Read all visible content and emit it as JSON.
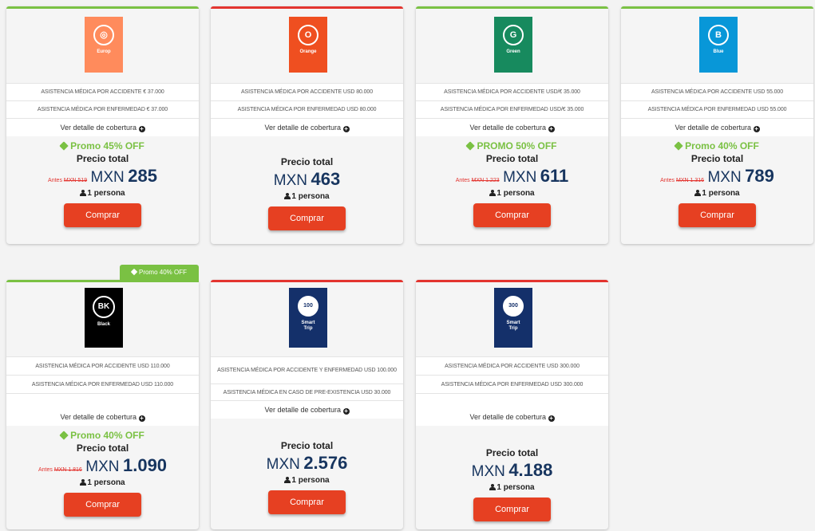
{
  "detail_label": "Ver detalle de cobertura",
  "total_label": "Precio total",
  "buy_label": "Comprar",
  "antes_label": "Antes",
  "colors": {
    "green": "#7ac143",
    "red": "#e3342f",
    "button": "#e64022",
    "price": "#17355f"
  },
  "cards": [
    {
      "logo": {
        "letter": "wifi-icon",
        "name": "Europ",
        "color": "#ff8b5c"
      },
      "benefits": [
        "ASISTENCIA MÉDICA POR ACCIDENTE € 37.000",
        "ASISTENCIA MÉDICA POR ENFERMEDAD € 37.000"
      ],
      "promo": "Promo 45% OFF",
      "antes": "MXN 519",
      "currency": "MXN",
      "price": "285",
      "persons": "1 persona"
    },
    {
      "logo": {
        "letter": "O",
        "name": "Orange",
        "color": "#ef4f20"
      },
      "benefits": [
        "ASISTENCIA MÉDICA POR ACCIDENTE USD 80.000",
        "ASISTENCIA MÉDICA POR ENFERMEDAD USD 80.000"
      ],
      "promo": "",
      "antes": "",
      "currency": "MXN",
      "price": "463",
      "persons": "1 persona"
    },
    {
      "logo": {
        "letter": "G",
        "name": "Green",
        "color": "#178a5e"
      },
      "benefits": [
        "ASISTENCIA MÉDICA POR ACCIDENTE USD/€ 35.000",
        "ASISTENCIA MÉDICA POR ENFERMEDAD USD/€ 35.000"
      ],
      "promo": "PROMO 50% OFF",
      "antes": "MXN 1.223",
      "currency": "MXN",
      "price": "611",
      "persons": "1 persona"
    },
    {
      "logo": {
        "letter": "B",
        "name": "Blue",
        "color": "#0897d8"
      },
      "benefits": [
        "ASISTENCIA MÉDICA POR ACCIDENTE USD 55.000",
        "ASISTENCIA MÉDICA POR ENFERMEDAD USD 55.000"
      ],
      "promo": "Promo 40% OFF",
      "antes": "MXN 1.316",
      "currency": "MXN",
      "price": "789",
      "persons": "1 persona"
    },
    {
      "ribbon": "Promo 40% OFF",
      "logo": {
        "letter": "BK",
        "name": "Black",
        "color": "#000000"
      },
      "benefits": [
        "ASISTENCIA MÉDICA POR ACCIDENTE USD 110.000",
        "ASISTENCIA MÉDICA POR ENFERMEDAD USD 110.000"
      ],
      "promo": "Promo 40% OFF",
      "antes": "MXN 1.816",
      "currency": "MXN",
      "price": "1.090",
      "persons": "1 persona"
    },
    {
      "logo": {
        "letter": "100",
        "name": "Smart Trip",
        "color": "#14306a"
      },
      "benefits": [
        "ASISTENCIA MÉDICA POR ACCIDENTE Y ENFERMEDAD USD 100.000",
        "ASISTENCIA MÉDICA EN CASO DE PRE-EXISTENCIA USD 30.000"
      ],
      "promo": "",
      "antes": "",
      "currency": "MXN",
      "price": "2.576",
      "persons": "1 persona"
    },
    {
      "logo": {
        "letter": "300",
        "name": "Smart Trip",
        "color": "#14306a"
      },
      "benefits": [
        "ASISTENCIA MÉDICA POR ACCIDENTE USD 300.000",
        "ASISTENCIA MÉDICA POR ENFERMEDAD USD 300.000"
      ],
      "promo": "",
      "antes": "",
      "currency": "MXN",
      "price": "4.188",
      "persons": "1 persona"
    }
  ]
}
